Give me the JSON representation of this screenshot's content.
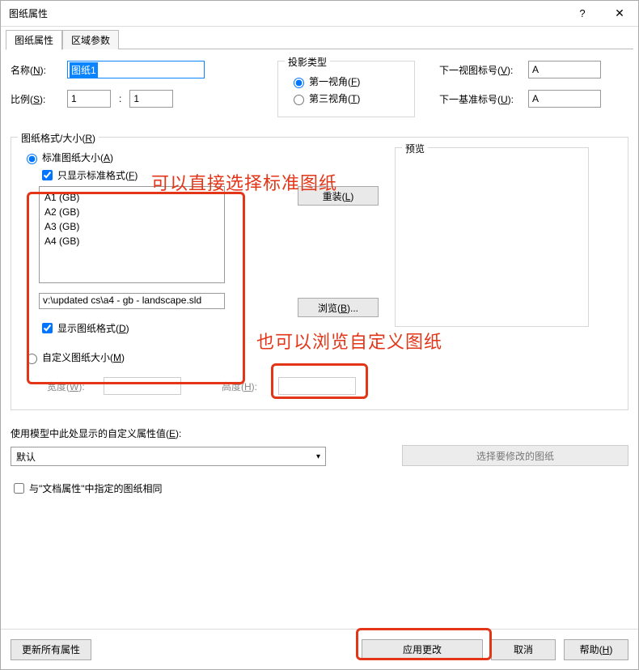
{
  "window": {
    "title": "图纸属性",
    "help_glyph": "?",
    "close_glyph": "✕"
  },
  "tabs": {
    "sheet_props": "图纸属性",
    "zone_params": "区域参数"
  },
  "name": {
    "label_prefix": "名称(",
    "label_u": "N",
    "label_suffix": "):",
    "value": "图纸1"
  },
  "ratio": {
    "label_prefix": "比例(",
    "label_u": "S",
    "label_suffix": "):",
    "num": "1",
    "den": "1",
    "colon": ":"
  },
  "projection": {
    "group": "投影类型",
    "first_prefix": "第一视角(",
    "first_u": "F",
    "first_suffix": ")",
    "third_prefix": "第三视角(",
    "third_u": "T",
    "third_suffix": ")"
  },
  "right": {
    "nextview_prefix": "下一视图标号(",
    "nextview_u": "V",
    "nextview_suffix": "):",
    "nextview_val": "A",
    "nextdatum_prefix": "下一基准标号(",
    "nextdatum_u": "U",
    "nextdatum_suffix": "):",
    "nextdatum_val": "A"
  },
  "format": {
    "group_prefix": "图纸格式/大小(",
    "group_u": "R",
    "group_suffix": ")",
    "std_prefix": "标准图纸大小(",
    "std_u": "A",
    "std_suffix": ")",
    "onlystd_prefix": "只显示标准格式(",
    "onlystd_u": "F",
    "onlystd_suffix": ")",
    "list": [
      "A1 (GB)",
      "A2 (GB)",
      "A3 (GB)",
      "A4 (GB)"
    ],
    "path": "v:\\updated cs\\a4 - gb - landscape.sld",
    "reload_prefix": "重装(",
    "reload_u": "L",
    "reload_suffix": ")",
    "browse_prefix": "浏览(",
    "browse_u": "B",
    "browse_suffix": ")...",
    "preview": "预览",
    "showfmt_prefix": "显示图纸格式(",
    "showfmt_u": "D",
    "showfmt_suffix": ")",
    "custom_prefix": "自定义图纸大小(",
    "custom_u": "M",
    "custom_suffix": ")",
    "width_prefix": "宽度(",
    "width_u": "W",
    "width_suffix": "):",
    "height_prefix": "高度(",
    "height_u": "H",
    "height_suffix": "):"
  },
  "customprops": {
    "label_prefix": "使用模型中此处显示的自定义属性值(",
    "label_u": "E",
    "label_suffix": "):",
    "selected": "默认",
    "selbtn": "选择要修改的图纸",
    "same": "与\"文档属性\"中指定的图纸相同"
  },
  "footer": {
    "update": "更新所有属性",
    "apply": "应用更改",
    "cancel": "取消",
    "help_prefix": "帮助(",
    "help_u": "H",
    "help_suffix": ")"
  },
  "annotations": {
    "a1": "可以直接选择标准图纸",
    "a2": "也可以浏览自定义图纸"
  }
}
